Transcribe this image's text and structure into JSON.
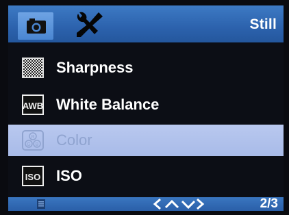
{
  "header": {
    "tabs": [
      {
        "icon": "camera-icon",
        "active": true
      },
      {
        "icon": "tools-icon",
        "active": false
      }
    ],
    "mode": "Still"
  },
  "menu": {
    "items": [
      {
        "label": "Sharpness",
        "icon": "sharpness-icon",
        "selected": false
      },
      {
        "label": "White Balance",
        "icon": "awb-icon",
        "icon_text": "AWB",
        "selected": false
      },
      {
        "label": "Color",
        "icon": "color-rgb-icon",
        "icon_text": "RGB",
        "selected": true
      },
      {
        "label": "ISO",
        "icon": "iso-icon",
        "icon_text": "ISO",
        "selected": false
      }
    ]
  },
  "footer": {
    "icon": "document-icon",
    "nav": "navigation-arrows-icon",
    "page": "2/3"
  },
  "colors": {
    "bar_blue": "#2c62ad",
    "active_tab": "#5a93dc",
    "selection": "#b0c1eb",
    "selected_text": "#8fa3cf",
    "text": "#ffffff",
    "background": "#0c0e15"
  }
}
